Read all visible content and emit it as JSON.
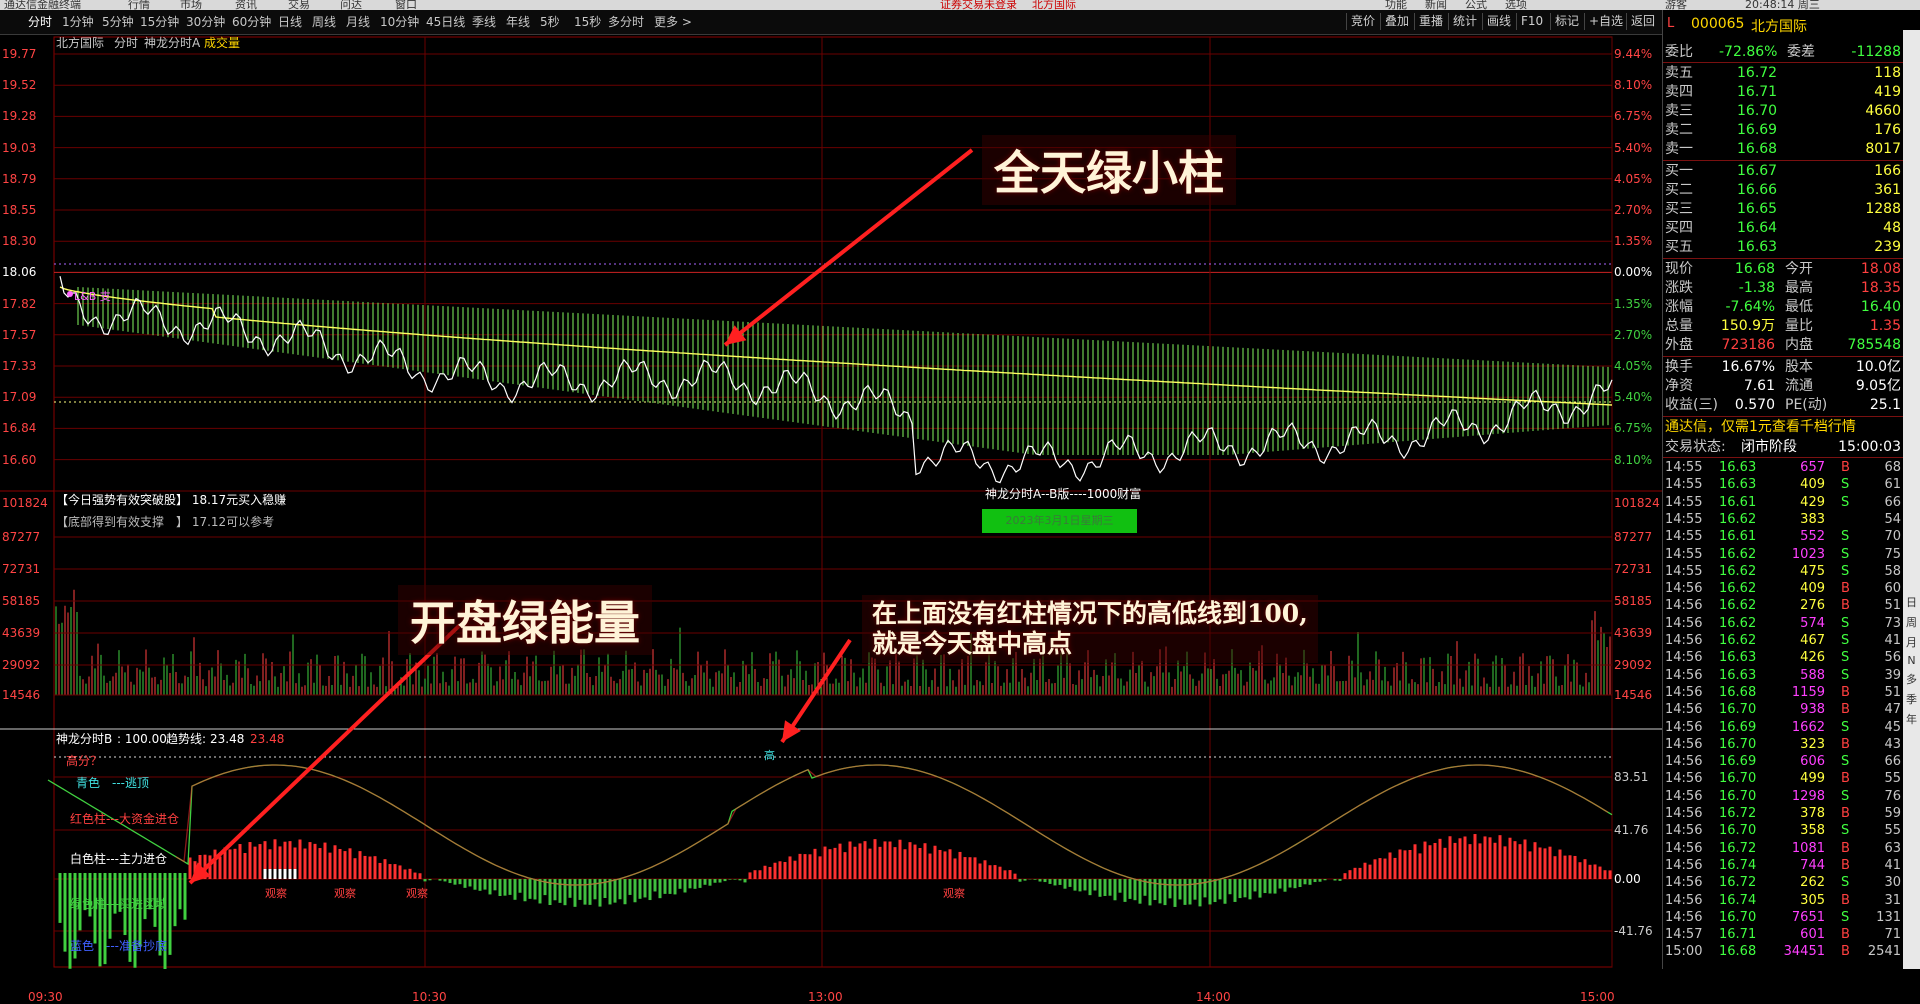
{
  "top_strip": [
    "通达信金融终端",
    "行情",
    "市场",
    "资讯",
    "交易",
    "问达",
    "窗口",
    "证券交易未登录",
    "北方国际",
    "功能",
    "新闻",
    "公式",
    "选项",
    "游客",
    "20:48:14 周三"
  ],
  "toolbar": {
    "periods": [
      "分时",
      "1分钟",
      "5分钟",
      "15分钟",
      "30分钟",
      "60分钟",
      "日线",
      "周线",
      "月线",
      "10分钟",
      "45日线",
      "季线",
      "年线",
      "5秒",
      "15秒",
      "多分时",
      "更多 >"
    ],
    "right_buttons": [
      "竞价",
      "叠加",
      "重播",
      "统计",
      "画线",
      "F10",
      "标记",
      "+自选",
      "返回"
    ]
  },
  "chart_header": {
    "stock": "北方国际",
    "mode": "分时",
    "indicator": "神龙分时A",
    "volume_label": "成交量"
  },
  "price_axis": [
    "19.77",
    "19.52",
    "19.28",
    "19.03",
    "18.79",
    "18.55",
    "18.30",
    "18.06",
    "17.82",
    "17.57",
    "17.33",
    "17.09",
    "16.84",
    "16.60"
  ],
  "pct_axis": [
    "9.44%",
    "8.10%",
    "6.75%",
    "5.40%",
    "4.05%",
    "2.70%",
    "1.35%",
    "0.00%",
    "1.35%",
    "2.70%",
    "4.05%",
    "5.40%",
    "6.75%",
    "8.10%"
  ],
  "volume_axis": [
    "101824",
    "87277",
    "72731",
    "58185",
    "43639",
    "29092",
    "14546"
  ],
  "indicator_axis": [
    "83.51",
    "41.76",
    "0.00",
    "-41.76"
  ],
  "time_axis": [
    "09:30",
    "10:30",
    "13:00",
    "14:00",
    "15:00"
  ],
  "price_notes": [
    {
      "text": "【今日强势有效突破股】 18.17元买入稳赚"
    },
    {
      "text": "【底部得到有效支撑　】 17.12可以参考"
    }
  ],
  "mid_label": "神龙分时A--B版----1000财富",
  "mid_badge": "2023年3月1日星期三",
  "small_marker": "L&B 支",
  "annotations": {
    "a1": "全天绿小柱",
    "a2": "开盘绿能量",
    "a3_line1": "在上面没有红柱情况下的高低线到100,",
    "a3_line2": "就是今天盘中高点"
  },
  "indicator_header": {
    "name": "神龙分时B",
    "v1": ": 100.00",
    "trend_label": "趋势线:",
    "trend_value": "23.48",
    "trend_value2": "23.48"
  },
  "indicator_legend": [
    {
      "text": "高分？",
      "color": "#ff4444"
    },
    {
      "text": "青色　---逃顶",
      "color": "#40e0e0"
    },
    {
      "text": "红色柱---大资金进仓",
      "color": "#ff4040"
    },
    {
      "text": "白色柱---主力进仓",
      "color": "#ffffff"
    },
    {
      "text": "绿色柱---买进区域",
      "color": "#40d040"
    },
    {
      "text": "蓝色　---准备抄底",
      "color": "#4060ff"
    }
  ],
  "observe_label": "观察",
  "high_label": "高",
  "quote": {
    "flag": "L",
    "code": "000065",
    "name": "北方国际",
    "weibi_label": "委比",
    "weibi": "-72.86%",
    "weicha_label": "委差",
    "weicha": "-11288",
    "asks": [
      {
        "label": "卖五",
        "price": "16.72",
        "vol": "118"
      },
      {
        "label": "卖四",
        "price": "16.71",
        "vol": "419"
      },
      {
        "label": "卖三",
        "price": "16.70",
        "vol": "4660"
      },
      {
        "label": "卖二",
        "price": "16.69",
        "vol": "176"
      },
      {
        "label": "卖一",
        "price": "16.68",
        "vol": "8017"
      }
    ],
    "bids": [
      {
        "label": "买一",
        "price": "16.67",
        "vol": "166"
      },
      {
        "label": "买二",
        "price": "16.66",
        "vol": "361"
      },
      {
        "label": "买三",
        "price": "16.65",
        "vol": "1288"
      },
      {
        "label": "买四",
        "price": "16.64",
        "vol": "48"
      },
      {
        "label": "买五",
        "price": "16.63",
        "vol": "239"
      }
    ],
    "stats": [
      {
        "l1": "现价",
        "v1": "16.68",
        "l2": "今开",
        "v2": "18.08",
        "c1": "#40ff40",
        "c2": "#ff4040"
      },
      {
        "l1": "涨跌",
        "v1": "-1.38",
        "l2": "最高",
        "v2": "18.35",
        "c1": "#40ff40",
        "c2": "#ff4040"
      },
      {
        "l1": "涨幅",
        "v1": "-7.64%",
        "l2": "最低",
        "v2": "16.40",
        "c1": "#40ff40",
        "c2": "#40ff40"
      },
      {
        "l1": "总量",
        "v1": "150.9万",
        "l2": "量比",
        "v2": "1.35",
        "c1": "#ffff40",
        "c2": "#ff4040"
      },
      {
        "l1": "外盘",
        "v1": "723186",
        "l2": "内盘",
        "v2": "785548",
        "c1": "#ff4040",
        "c2": "#40ff40"
      }
    ],
    "stats2": [
      {
        "l1": "换手",
        "v1": "16.67%",
        "l2": "股本",
        "v2": "10.0亿"
      },
      {
        "l1": "净资",
        "v1": "7.61",
        "l2": "流通",
        "v2": "9.05亿"
      },
      {
        "l1": "收益(三)",
        "v1": "0.570",
        "l2": "PE(动)",
        "v2": "25.1"
      }
    ],
    "promo": "通达信，仅需1元查看千档行情",
    "trade_status_label": "交易状态:",
    "trade_status": "闭市阶段",
    "trade_time": "15:00:03"
  },
  "ticks": [
    [
      "14:55",
      "16.63",
      "657",
      "B",
      "68"
    ],
    [
      "14:55",
      "16.63",
      "409",
      "S",
      "61"
    ],
    [
      "14:55",
      "16.61",
      "429",
      "S",
      "66"
    ],
    [
      "14:55",
      "16.62",
      "383",
      "",
      "54"
    ],
    [
      "14:55",
      "16.61",
      "552",
      "S",
      "70"
    ],
    [
      "14:55",
      "16.62",
      "1023",
      "S",
      "75"
    ],
    [
      "14:55",
      "16.62",
      "475",
      "S",
      "58"
    ],
    [
      "14:56",
      "16.62",
      "409",
      "B",
      "60"
    ],
    [
      "14:56",
      "16.62",
      "276",
      "B",
      "51"
    ],
    [
      "14:56",
      "16.62",
      "574",
      "S",
      "73"
    ],
    [
      "14:56",
      "16.62",
      "467",
      "S",
      "41"
    ],
    [
      "14:56",
      "16.63",
      "426",
      "S",
      "56"
    ],
    [
      "14:56",
      "16.63",
      "588",
      "S",
      "39"
    ],
    [
      "14:56",
      "16.68",
      "1159",
      "B",
      "51"
    ],
    [
      "14:56",
      "16.70",
      "938",
      "B",
      "47"
    ],
    [
      "14:56",
      "16.69",
      "1662",
      "S",
      "45"
    ],
    [
      "14:56",
      "16.70",
      "323",
      "B",
      "43"
    ],
    [
      "14:56",
      "16.69",
      "606",
      "S",
      "66"
    ],
    [
      "14:56",
      "16.70",
      "499",
      "B",
      "55"
    ],
    [
      "14:56",
      "16.70",
      "1298",
      "S",
      "76"
    ],
    [
      "14:56",
      "16.72",
      "378",
      "B",
      "59"
    ],
    [
      "14:56",
      "16.70",
      "358",
      "S",
      "55"
    ],
    [
      "14:56",
      "16.72",
      "1081",
      "B",
      "63"
    ],
    [
      "14:56",
      "16.74",
      "744",
      "B",
      "41"
    ],
    [
      "14:56",
      "16.72",
      "262",
      "S",
      "30"
    ],
    [
      "14:56",
      "16.74",
      "305",
      "B",
      "31"
    ],
    [
      "14:56",
      "16.70",
      "7651",
      "S",
      "131"
    ],
    [
      "14:57",
      "16.71",
      "601",
      "B",
      "71"
    ],
    [
      "15:00",
      "16.68",
      "34451",
      "B",
      "2541"
    ]
  ],
  "side_buttons": [
    "日",
    "周",
    "月",
    "N",
    "多",
    "季",
    "年"
  ],
  "colors": {
    "up": "#ff4040",
    "down": "#40d040",
    "grid": "#8a0000",
    "price_line": "#ffffff",
    "avg_line": "#ffff60"
  }
}
